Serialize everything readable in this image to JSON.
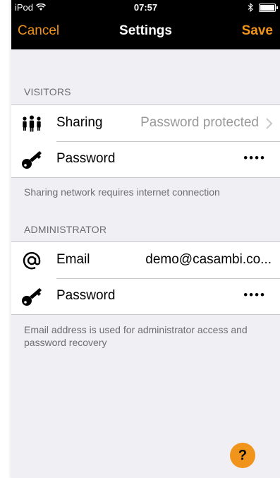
{
  "status_bar": {
    "carrier": "iPod",
    "time": "07:57"
  },
  "nav": {
    "cancel_label": "Cancel",
    "title": "Settings",
    "save_label": "Save"
  },
  "visitors": {
    "header": "VISITORS",
    "sharing": {
      "label": "Sharing",
      "value": "Password protected"
    },
    "password": {
      "label": "Password",
      "value": "••••"
    },
    "footer": "Sharing network requires internet connection"
  },
  "administrator": {
    "header": "ADMINISTRATOR",
    "email": {
      "label": "Email",
      "value": "demo@casambi.co..."
    },
    "password": {
      "label": "Password",
      "value": "••••"
    },
    "footer": "Email address is used for administrator access and password recovery"
  },
  "help_button": {
    "label": "?"
  },
  "colors": {
    "accent": "#f0941b",
    "nav_bg": "#000000",
    "page_bg": "#efeff4"
  },
  "icons": [
    "wifi-icon",
    "bluetooth-icon",
    "battery-icon",
    "people-icon",
    "key-icon",
    "at-icon",
    "chevron-right-icon"
  ]
}
